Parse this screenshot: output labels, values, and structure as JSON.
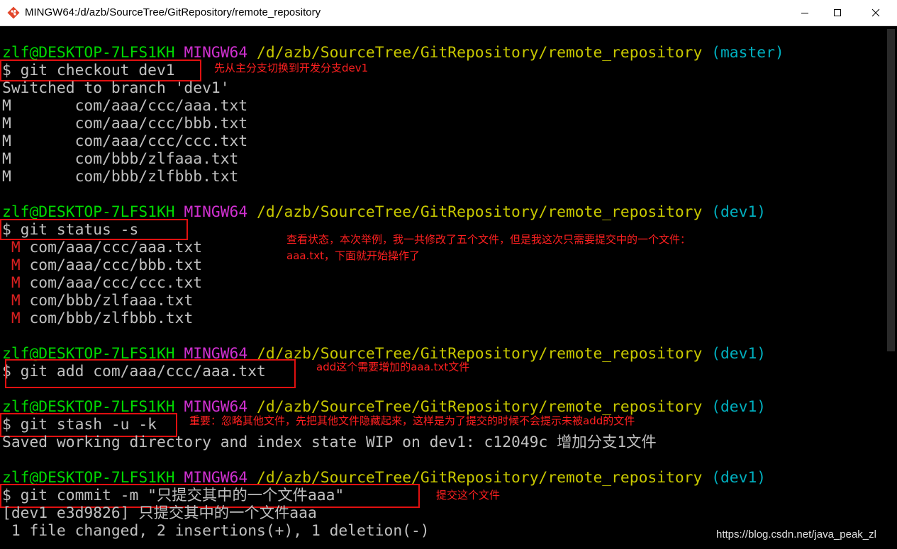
{
  "window": {
    "title": "MINGW64:/d/azb/SourceTree/GitRepository/remote_repository",
    "icon": "git-bash-icon",
    "controls": {
      "minimize": "minimize-icon",
      "maximize": "maximize-icon",
      "close": "close-icon"
    }
  },
  "terminal": {
    "colors": {
      "user": "#00d800",
      "mingw": "#d030d0",
      "path": "#c8c800",
      "branch": "#00b0c0",
      "modified": "#d82020",
      "annotation": "#ff2020"
    },
    "blocks": [
      {
        "prompt": {
          "user": "zlf@DESKTOP-7LFS1KH",
          "env": "MINGW64",
          "path": "/d/azb/SourceTree/GitRepository/remote_repository",
          "branch": "(master)"
        },
        "command": "$ git checkout dev1",
        "output": [
          "Switched to branch 'dev1'",
          "M       com/aaa/ccc/aaa.txt",
          "M       com/aaa/ccc/bbb.txt",
          "M       com/aaa/ccc/ccc.txt",
          "M       com/bbb/zlfaaa.txt",
          "M       com/bbb/zlfbbb.txt"
        ],
        "annotation": "先从主分支切换到开发分支dev1"
      },
      {
        "prompt": {
          "user": "zlf@DESKTOP-7LFS1KH",
          "env": "MINGW64",
          "path": "/d/azb/SourceTree/GitRepository/remote_repository",
          "branch": "(dev1)"
        },
        "command": "$ git status -s",
        "status_flag": "M",
        "output": [
          "com/aaa/ccc/aaa.txt",
          "com/aaa/ccc/bbb.txt",
          "com/aaa/ccc/ccc.txt",
          "com/bbb/zlfaaa.txt",
          "com/bbb/zlfbbb.txt"
        ],
        "annotation_lines": [
          "查看状态，本次举例，我一共修改了五个文件，但是我这次只需要提交中的一个文件：",
          "aaa.txt，下面就开始操作了"
        ]
      },
      {
        "prompt": {
          "user": "zlf@DESKTOP-7LFS1KH",
          "env": "MINGW64",
          "path": "/d/azb/SourceTree/GitRepository/remote_repository",
          "branch": "(dev1)"
        },
        "command": "$ git add com/aaa/ccc/aaa.txt",
        "annotation": "add这个需要增加的aaa.txt文件"
      },
      {
        "prompt": {
          "user": "zlf@DESKTOP-7LFS1KH",
          "env": "MINGW64",
          "path": "/d/azb/SourceTree/GitRepository/remote_repository",
          "branch": "(dev1)"
        },
        "command": "$ git stash -u -k",
        "output": [
          "Saved working directory and index state WIP on dev1: c12049c 增加分支1文件"
        ],
        "annotation": "重要：忽略其他文件，先把其他文件隐藏起来，这样是为了提交的时候不会提示未被add的文件"
      },
      {
        "prompt": {
          "user": "zlf@DESKTOP-7LFS1KH",
          "env": "MINGW64",
          "path": "/d/azb/SourceTree/GitRepository/remote_repository",
          "branch": "(dev1)"
        },
        "command": "$ git commit -m \"只提交其中的一个文件aaa\"",
        "output": [
          "[dev1 e3d9826] 只提交其中的一个文件aaa",
          " 1 file changed, 2 insertions(+), 1 deletion(-)"
        ],
        "annotation": "提交这个文件"
      }
    ]
  },
  "watermark": "https://blog.csdn.net/java_peak_zl"
}
